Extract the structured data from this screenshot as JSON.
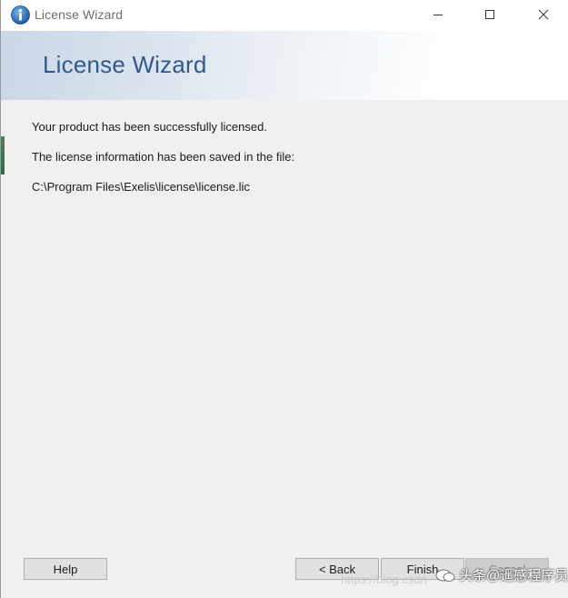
{
  "window": {
    "title": "License Wizard"
  },
  "header": {
    "title": "License Wizard"
  },
  "content": {
    "line1": "Your product has been successfully licensed.",
    "line2": "The license information has been saved in the file:",
    "file_path": "C:\\Program Files\\Exelis\\license\\license.lic"
  },
  "buttons": {
    "help": "Help",
    "back": "< Back",
    "finish": "Finish",
    "cancel": "Cancel"
  },
  "watermark": {
    "url": "https://blog.csdn",
    "text": "头条@遥感程序员"
  },
  "colors": {
    "header_title": "#33588c",
    "header_gradient_start": "#cad7e6",
    "background": "#f0f0f0"
  },
  "icons": {
    "app": "info-icon",
    "minimize": "minimize-icon",
    "maximize": "maximize-icon",
    "close": "close-icon"
  }
}
